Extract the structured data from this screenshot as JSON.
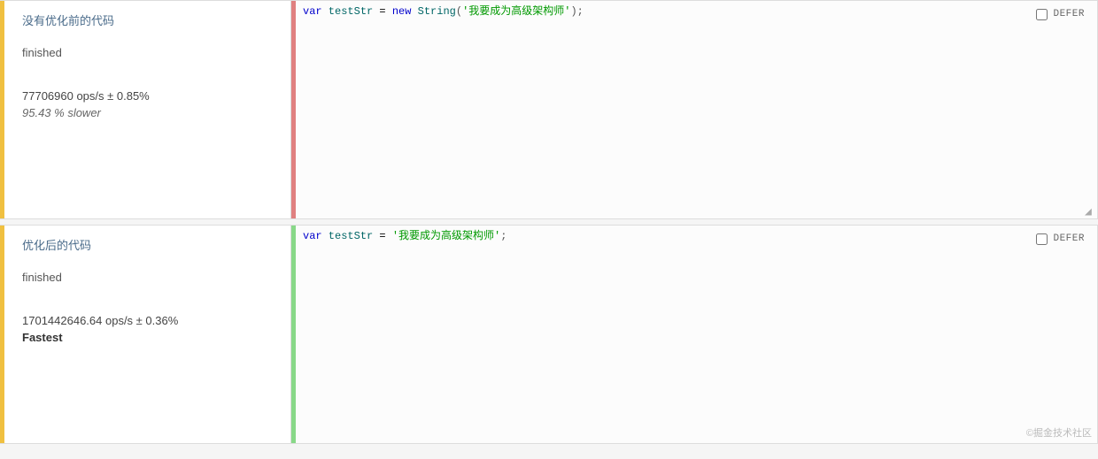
{
  "rows": [
    {
      "title": "没有优化前的代码",
      "status": "finished",
      "ops": "77706960 ops/s ± 0.85%",
      "result": "95.43 % slower",
      "fastest": false,
      "accent": "red",
      "code": {
        "kw1": "var",
        "ident": " testStr ",
        "op1": "=",
        "kw2": " new ",
        "ctor": "String",
        "p_open": "(",
        "str": "'我要成为高级架构师'",
        "p_close": ")",
        "semi": ";"
      },
      "defer_label": "DEFER"
    },
    {
      "title": "优化后的代码",
      "status": "finished",
      "ops": "1701442646.64 ops/s ± 0.36%",
      "result": "Fastest",
      "fastest": true,
      "accent": "green",
      "code": {
        "kw1": "var",
        "ident": " testStr ",
        "op1": "=",
        "sp": " ",
        "str": "'我要成为高级架构师'",
        "semi": ";"
      },
      "defer_label": "DEFER"
    }
  ],
  "watermark": "©掘金技术社区"
}
